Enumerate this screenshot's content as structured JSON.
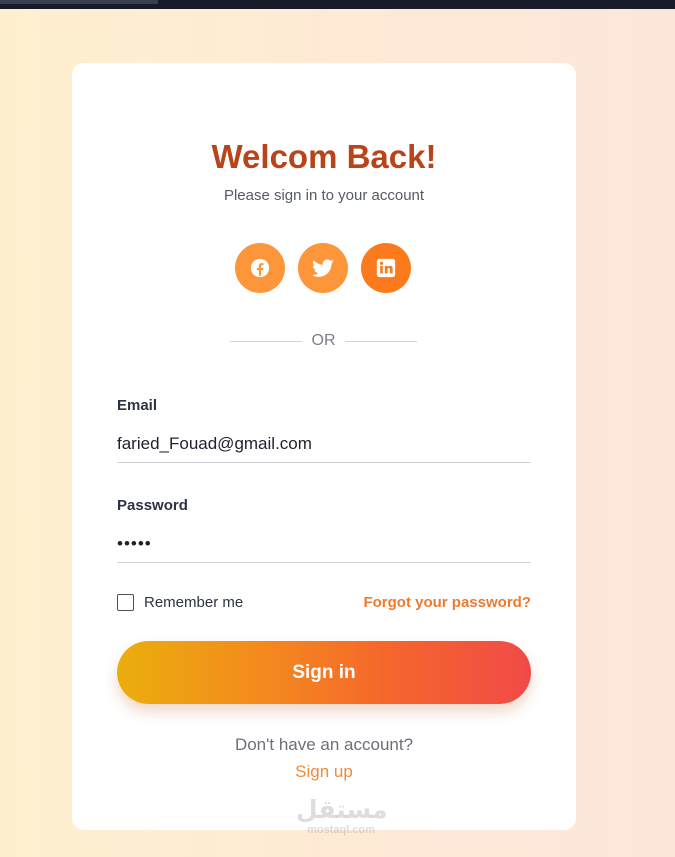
{
  "header": {
    "title": "Welcom Back!",
    "subtitle": "Please sign in to your account"
  },
  "social": {
    "buttons": [
      {
        "name": "facebook",
        "icon": "facebook-icon"
      },
      {
        "name": "twitter",
        "icon": "twitter-icon"
      },
      {
        "name": "linkedin",
        "icon": "linkedin-icon"
      }
    ]
  },
  "divider": {
    "text": "OR"
  },
  "form": {
    "email_label": "Email",
    "email_value": "faried_Fouad@gmail.com",
    "password_label": "Password",
    "password_value": "•••••",
    "remember_label": "Remember me",
    "remember_checked": false,
    "forgot_label": "Forgot your password?",
    "submit_label": "Sign in"
  },
  "footer": {
    "prompt": "Don't have an account?",
    "signup_label": "Sign up"
  },
  "watermark": {
    "logo": "مستقل",
    "url": "mostaql.com"
  },
  "colors": {
    "title": "#b9441a",
    "accent": "#fd953b",
    "linkedin": "#fb7a1c",
    "link": "#ee7a2e",
    "gradient_start": "#eaae0c",
    "gradient_end": "#f14a48"
  }
}
